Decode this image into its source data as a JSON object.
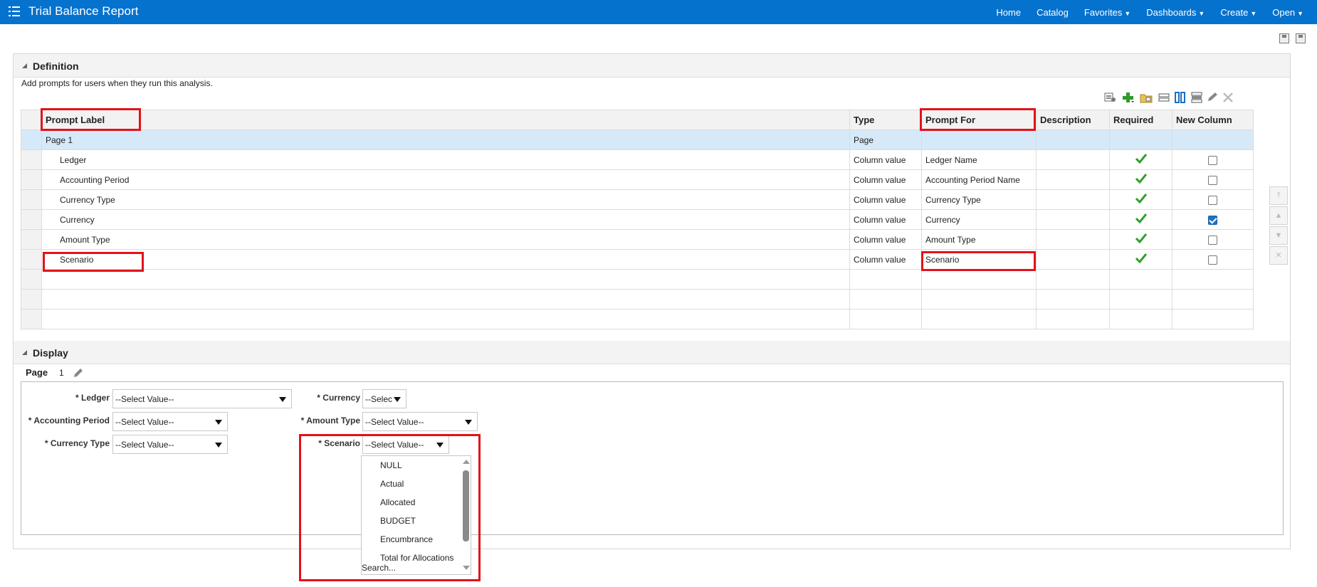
{
  "header": {
    "title": "Trial Balance Report",
    "nav": [
      {
        "label": "Home",
        "caret": false
      },
      {
        "label": "Catalog",
        "caret": false
      },
      {
        "label": "Favorites",
        "caret": true
      },
      {
        "label": "Dashboards",
        "caret": true
      },
      {
        "label": "Create",
        "caret": true
      },
      {
        "label": "Open",
        "caret": true
      }
    ],
    "color": "#0572ce"
  },
  "definition": {
    "header": "Definition",
    "help": "Add prompts for users when they run this analysis.",
    "columns": [
      "Prompt Label",
      "Type",
      "Prompt For",
      "Description",
      "Required",
      "New Column"
    ],
    "rows": [
      {
        "label": "Page 1",
        "type": "Page",
        "prompt_for": "",
        "required": false,
        "new_column": false,
        "is_page": true
      },
      {
        "label": "Ledger",
        "type": "Column value",
        "prompt_for": "Ledger Name",
        "required": true,
        "new_column": false
      },
      {
        "label": "Accounting Period",
        "type": "Column value",
        "prompt_for": "Accounting Period Name",
        "required": true,
        "new_column": false
      },
      {
        "label": "Currency Type",
        "type": "Column value",
        "prompt_for": "Currency Type",
        "required": true,
        "new_column": false
      },
      {
        "label": "Currency",
        "type": "Column value",
        "prompt_for": "Currency",
        "required": true,
        "new_column": true
      },
      {
        "label": "Amount Type",
        "type": "Column value",
        "prompt_for": "Amount Type",
        "required": true,
        "new_column": false
      },
      {
        "label": "Scenario",
        "type": "Column value",
        "prompt_for": "Scenario",
        "required": true,
        "new_column": false
      }
    ]
  },
  "display": {
    "header": "Display",
    "page_label": "Page",
    "page_number": "1",
    "prompts": {
      "ledger": {
        "label": "* Ledger",
        "value": "--Select Value--"
      },
      "accounting_period": {
        "label": "* Accounting Period",
        "value": "--Select Value--"
      },
      "currency_type": {
        "label": "* Currency Type",
        "value": "--Select Value--"
      },
      "currency": {
        "label": "* Currency",
        "value": "--Selec"
      },
      "amount_type": {
        "label": "* Amount Type",
        "value": "--Select Value--"
      },
      "scenario": {
        "label": "* Scenario",
        "value": "--Select Value--"
      }
    },
    "scenario_options": [
      "NULL",
      "Actual",
      "Allocated",
      "BUDGET",
      "Encumbrance",
      "Total for Allocations"
    ],
    "search_label": "Search..."
  }
}
